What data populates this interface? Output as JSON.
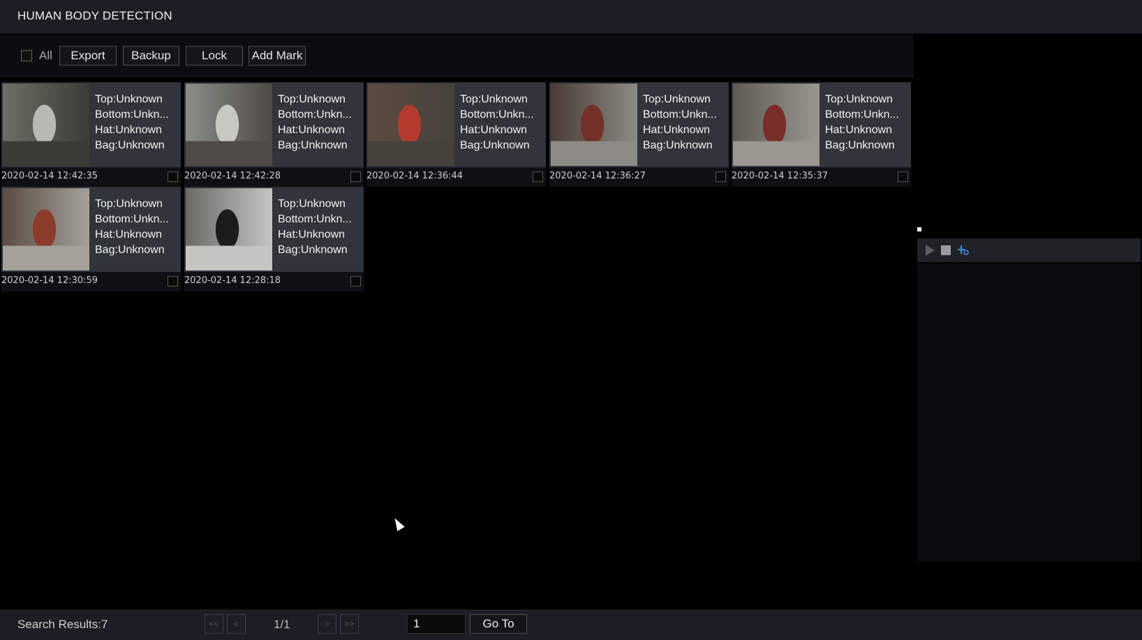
{
  "header": {
    "title": "HUMAN BODY DETECTION"
  },
  "toolbar": {
    "all_label": "All",
    "export_label": "Export",
    "backup_label": "Backup",
    "lock_label": "Lock",
    "add_mark_label": "Add Mark"
  },
  "results": [
    {
      "top": "Top:Unknown",
      "bottom": "Bottom:Unkn...",
      "hat": "Hat:Unknown",
      "bag": "Bag:Unknown",
      "timestamp": "2020-02-14 12:42:35",
      "thumb_colors": [
        "#6b6f65",
        "#b7b9b3",
        "#3a3d35"
      ]
    },
    {
      "top": "Top:Unknown",
      "bottom": "Bottom:Unkn...",
      "hat": "Hat:Unknown",
      "bag": "Bag:Unknown",
      "timestamp": "2020-02-14 12:42:28",
      "thumb_colors": [
        "#8a8d88",
        "#c8c8c3",
        "#4e4a46"
      ]
    },
    {
      "top": "Top:Unknown",
      "bottom": "Bottom:Unkn...",
      "hat": "Hat:Unknown",
      "bag": "Bag:Unknown",
      "timestamp": "2020-02-14 12:36:44",
      "thumb_colors": [
        "#5c4a40",
        "#b43c2e",
        "#45423b"
      ]
    },
    {
      "top": "Top:Unknown",
      "bottom": "Bottom:Unkn...",
      "hat": "Hat:Unknown",
      "bag": "Bag:Unknown",
      "timestamp": "2020-02-14 12:36:27",
      "thumb_colors": [
        "#4b3b36",
        "#73312a",
        "#8d8b85"
      ]
    },
    {
      "top": "Top:Unknown",
      "bottom": "Bottom:Unkn...",
      "hat": "Hat:Unknown",
      "bag": "Bag:Unknown",
      "timestamp": "2020-02-14 12:35:37",
      "thumb_colors": [
        "#5e5a54",
        "#7a2e2a",
        "#9a9791"
      ]
    },
    {
      "top": "Top:Unknown",
      "bottom": "Bottom:Unkn...",
      "hat": "Hat:Unknown",
      "bag": "Bag:Unknown",
      "timestamp": "2020-02-14 12:30:59",
      "thumb_colors": [
        "#5b4c44",
        "#8c3b2a",
        "#a4a19a"
      ]
    },
    {
      "top": "Top:Unknown",
      "bottom": "Bottom:Unkn...",
      "hat": "Hat:Unknown",
      "bag": "Bag:Unknown",
      "timestamp": "2020-02-14 12:28:18",
      "thumb_colors": [
        "#6a6a66",
        "#1c1c1c",
        "#c4c4c0"
      ]
    }
  ],
  "footer": {
    "search_results": "Search Results:7",
    "first_label": "<<",
    "prev_label": "<",
    "page_indicator": "1/1",
    "next_label": ">",
    "last_label": ">>",
    "goto_value": "1",
    "goto_label": "Go To"
  },
  "icons": {
    "play": "play-icon",
    "stop": "stop-icon",
    "clip": "clip-icon"
  },
  "colors": {
    "header_bg": "#1b1e24",
    "card_bg": "#31343a",
    "accent_blue": "#3c8de8"
  }
}
